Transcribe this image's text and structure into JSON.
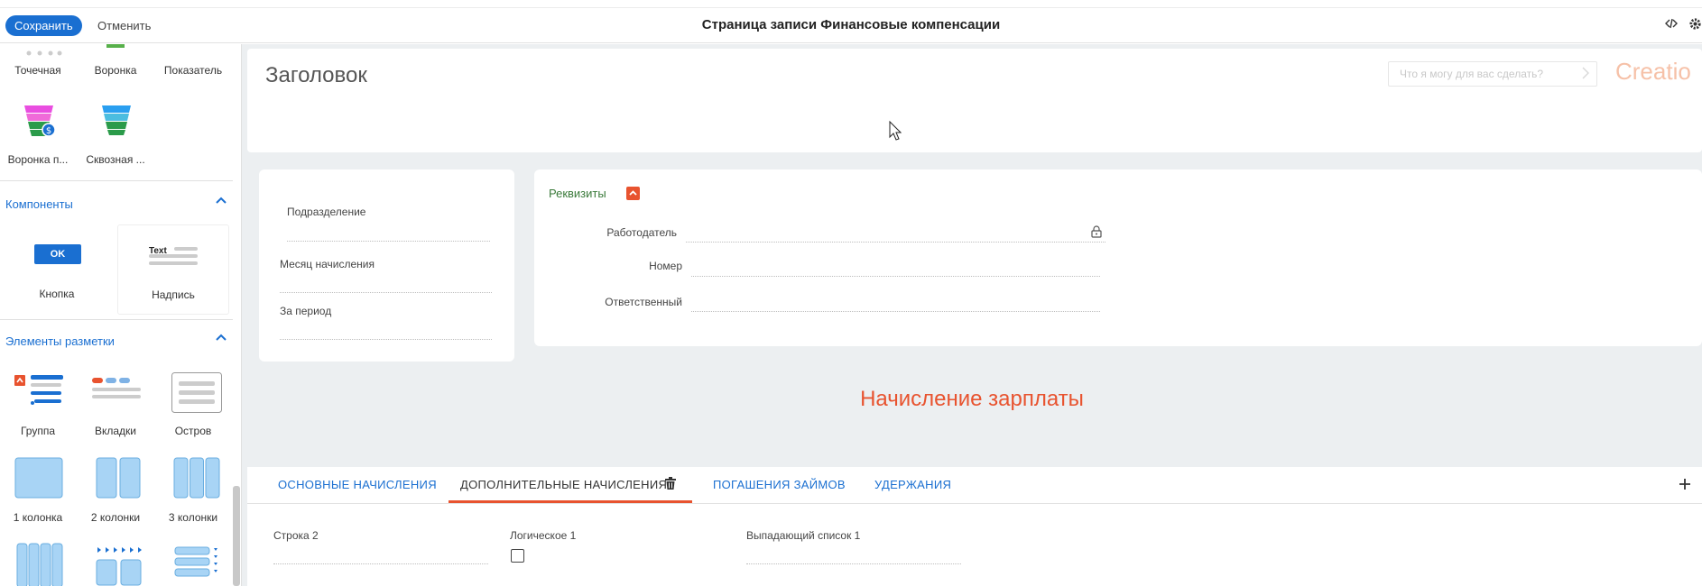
{
  "topbar": {
    "save_label": "Сохранить",
    "cancel_label": "Отменить",
    "title": "Страница записи Финансовые компенсации",
    "icons": [
      "code-icon",
      "gear-icon"
    ]
  },
  "left_panel": {
    "chart_tiles": [
      {
        "label": "Точечная"
      },
      {
        "label": "Воронка"
      },
      {
        "label": "Показатель"
      },
      {
        "label": "Воронка п..."
      },
      {
        "label": "Сквозная ..."
      }
    ],
    "components": {
      "heading": "Компоненты",
      "items": [
        {
          "label": "Кнопка",
          "preview": "OK"
        },
        {
          "label": "Надпись",
          "preview": "Text"
        }
      ]
    },
    "layout_elements": {
      "heading": "Элементы разметки",
      "items": [
        {
          "label": "Группа"
        },
        {
          "label": "Вкладки"
        },
        {
          "label": "Остров"
        },
        {
          "label": "1 колонка"
        },
        {
          "label": "2 колонки"
        },
        {
          "label": "3 колонки"
        }
      ]
    }
  },
  "header_card": {
    "title": "Заголовок",
    "search_placeholder": "Что я могу для вас сделать?",
    "logo": "Creatio"
  },
  "left_card": {
    "fields": [
      {
        "label": "Подразделение"
      },
      {
        "label": "Месяц начисления"
      },
      {
        "label": "За период"
      }
    ]
  },
  "requisites": {
    "title": "Реквизиты",
    "fields": [
      {
        "label": "Работодатель"
      },
      {
        "label": "Номер"
      },
      {
        "label": "Ответственный"
      }
    ]
  },
  "section_label": "Начисление зарплаты",
  "tabs": [
    {
      "label": "ОСНОВНЫЕ НАЧИСЛЕНИЯ"
    },
    {
      "label": "ДОПОЛНИТЕЛЬНЫЕ НАЧИСЛЕНИЯ"
    },
    {
      "label": "ПОГАШЕНИЯ ЗАЙМОВ"
    },
    {
      "label": "УДЕРЖАНИЯ"
    }
  ],
  "tab_fields": [
    {
      "label": "Строка 2"
    },
    {
      "label": "Логическое 1"
    },
    {
      "label": "Выпадающий список 1"
    }
  ],
  "colors": {
    "accent": "#1a6fd1",
    "danger": "#e8532f",
    "group_title": "#3a7a3a",
    "canvas_bg": "#eceff1"
  }
}
